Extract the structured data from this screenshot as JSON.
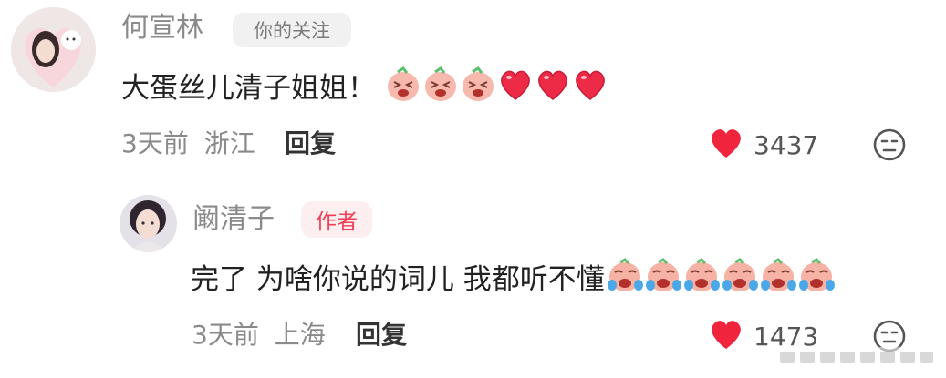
{
  "comment": {
    "author": "何宣林",
    "badge": "你的关注",
    "text": "大蛋丝儿清子姐姐！",
    "time": "3天前",
    "location": "浙江",
    "reply_label": "回复",
    "likes": "3437"
  },
  "reply": {
    "author": "阚清子",
    "badge": "作者",
    "text": "完了 为啥你说的词儿 我都听不懂",
    "time": "3天前",
    "location": "上海",
    "reply_label": "回复",
    "likes": "1473"
  },
  "colors": {
    "like": "#f0243c",
    "author_badge": "#ee3f55"
  }
}
